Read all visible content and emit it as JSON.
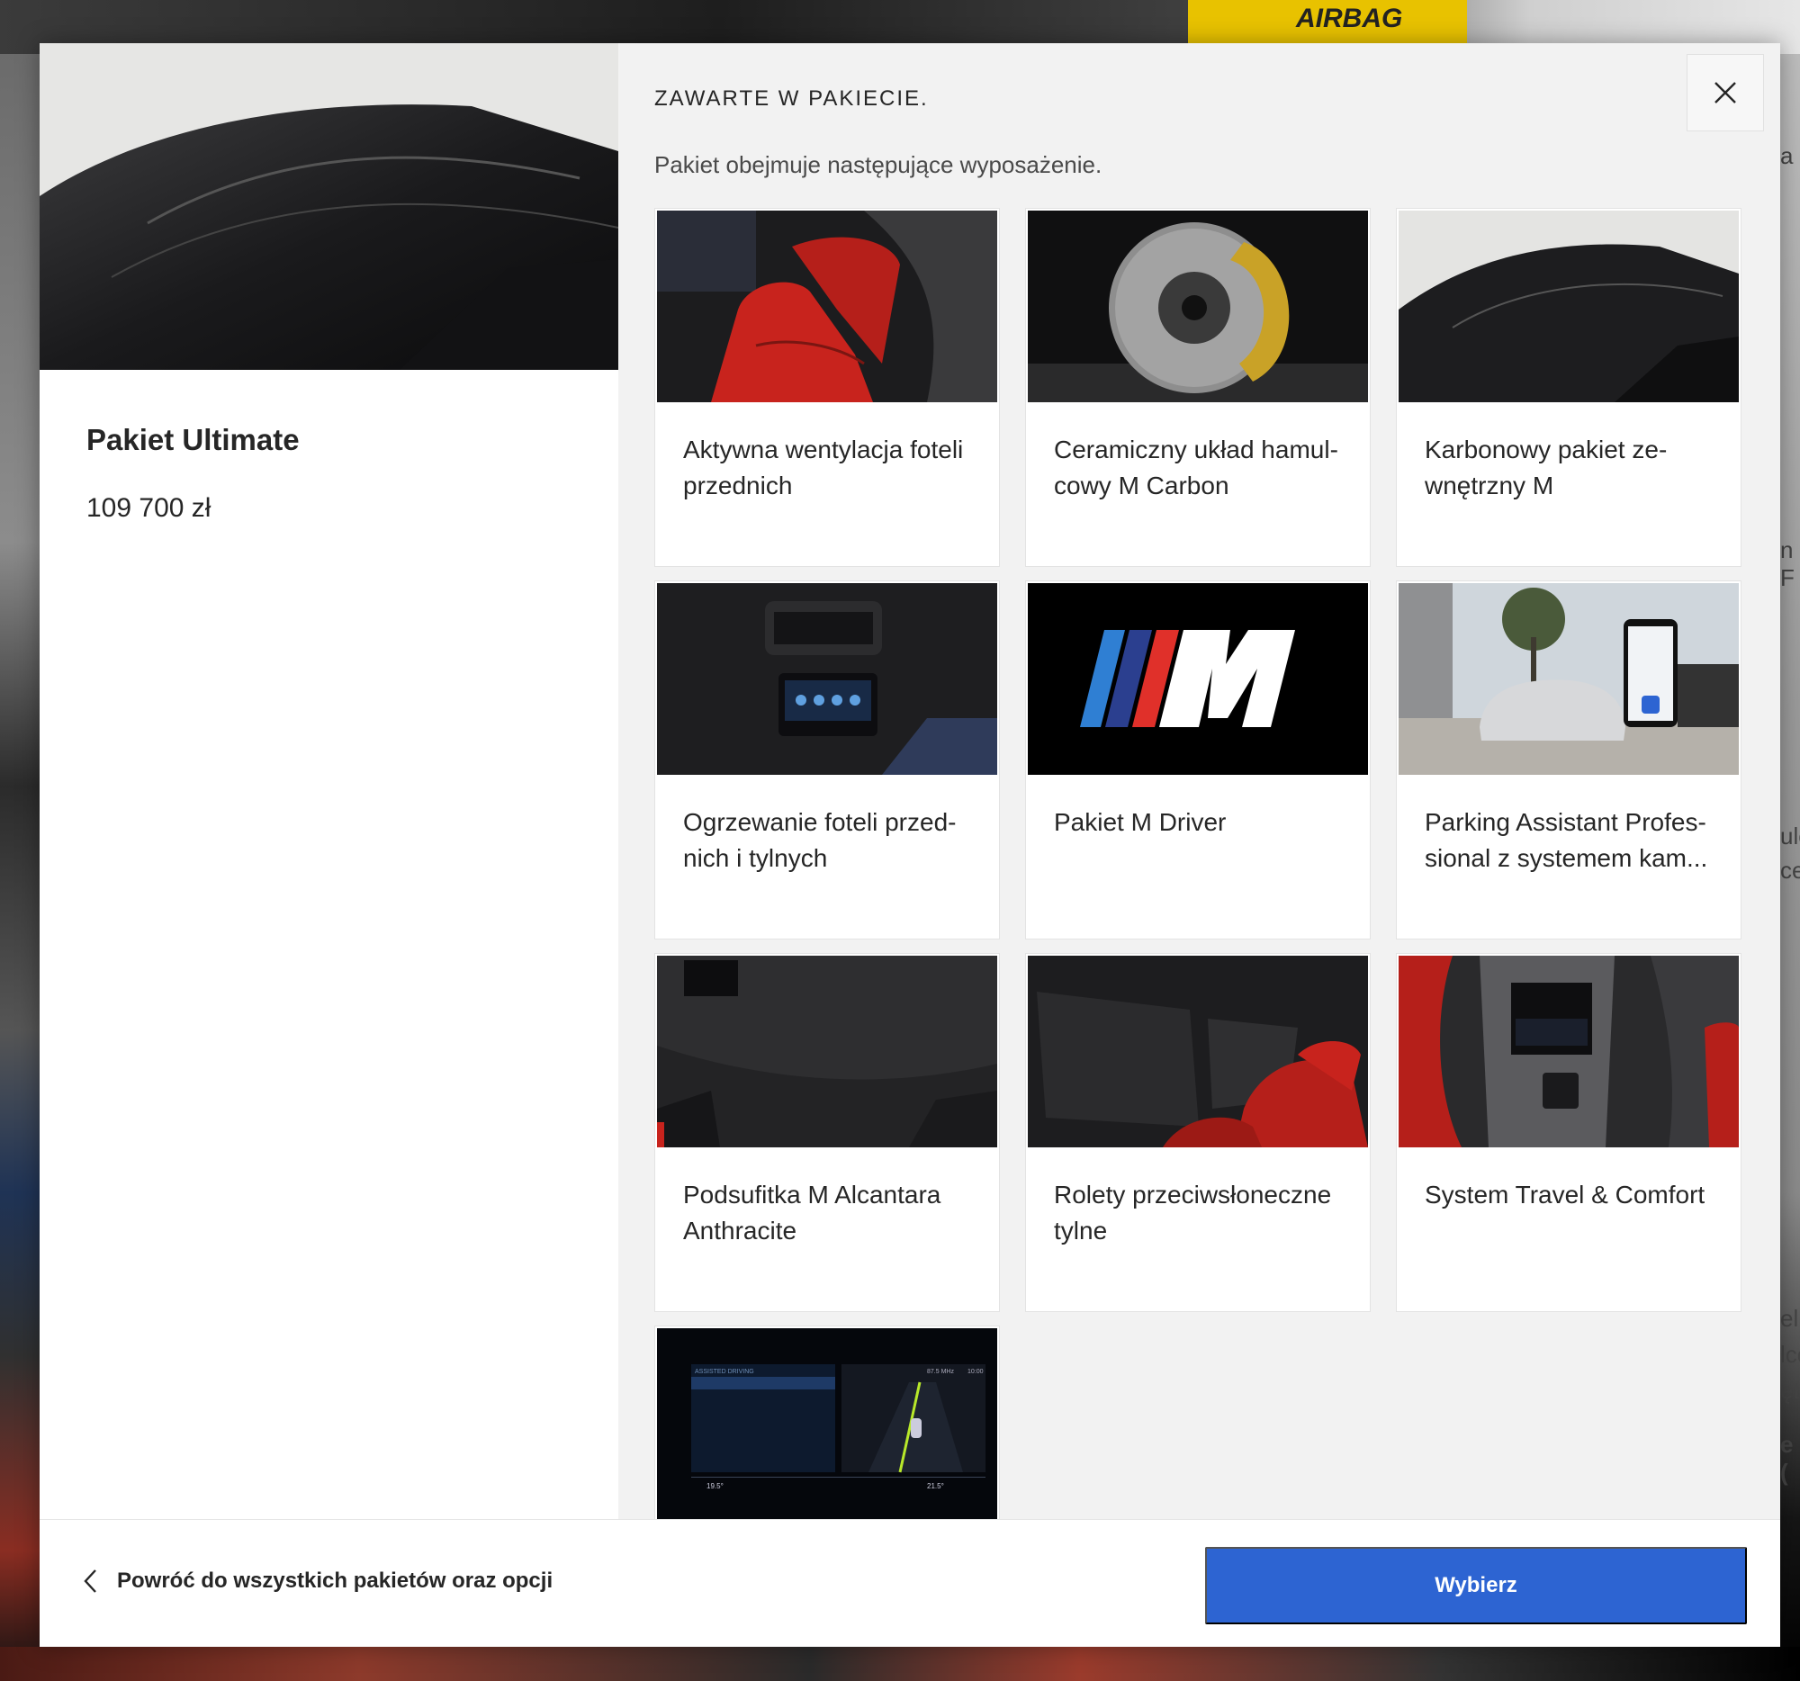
{
  "background": {
    "airbag_label": "AIRBAG",
    "right_edge_letters": [
      "a",
      "n F",
      "ulc",
      "ce",
      "eli",
      "lco",
      "ętr",
      "e ("
    ]
  },
  "package": {
    "name": "Pakiet Ultimate",
    "price": "109 700 zł"
  },
  "section": {
    "title": "ZAWARTE W PAKIECIE.",
    "subtitle": "Pakiet obejmuje następujące wyposażenie."
  },
  "items": [
    {
      "label": "Aktywna wentylacja foteli przednich"
    },
    {
      "label": "Ceramiczny układ hamul­cowy M Carbon"
    },
    {
      "label": "Karbonowy pakiet ze­wnętrzny M"
    },
    {
      "label": "Ogrzewanie foteli przed­nich i tylnych"
    },
    {
      "label": "Pakiet M Driver"
    },
    {
      "label": "Parking Assistant Profes­sional z systemem kam..."
    },
    {
      "label": "Podsufitka M Alcantara Anthracite"
    },
    {
      "label": "Rolety przeciwsłoneczne tylne"
    },
    {
      "label": "System Travel & Comfort"
    },
    {
      "label": ""
    }
  ],
  "screen_thumb": {
    "header_left": "ASSISTED DRIVING",
    "radio": "87.5 MHz",
    "time": "10:00",
    "temp_left": "19.5°",
    "temp_right": "21.5°"
  },
  "footer": {
    "back_label": "Powróć do wszystkich pakietów oraz opcji",
    "select_label": "Wybierz"
  },
  "colors": {
    "accent": "#2d64d2",
    "m_blue_light": "#2f7fd3",
    "m_blue_dark": "#2b3f8f",
    "m_red": "#e0302a"
  }
}
